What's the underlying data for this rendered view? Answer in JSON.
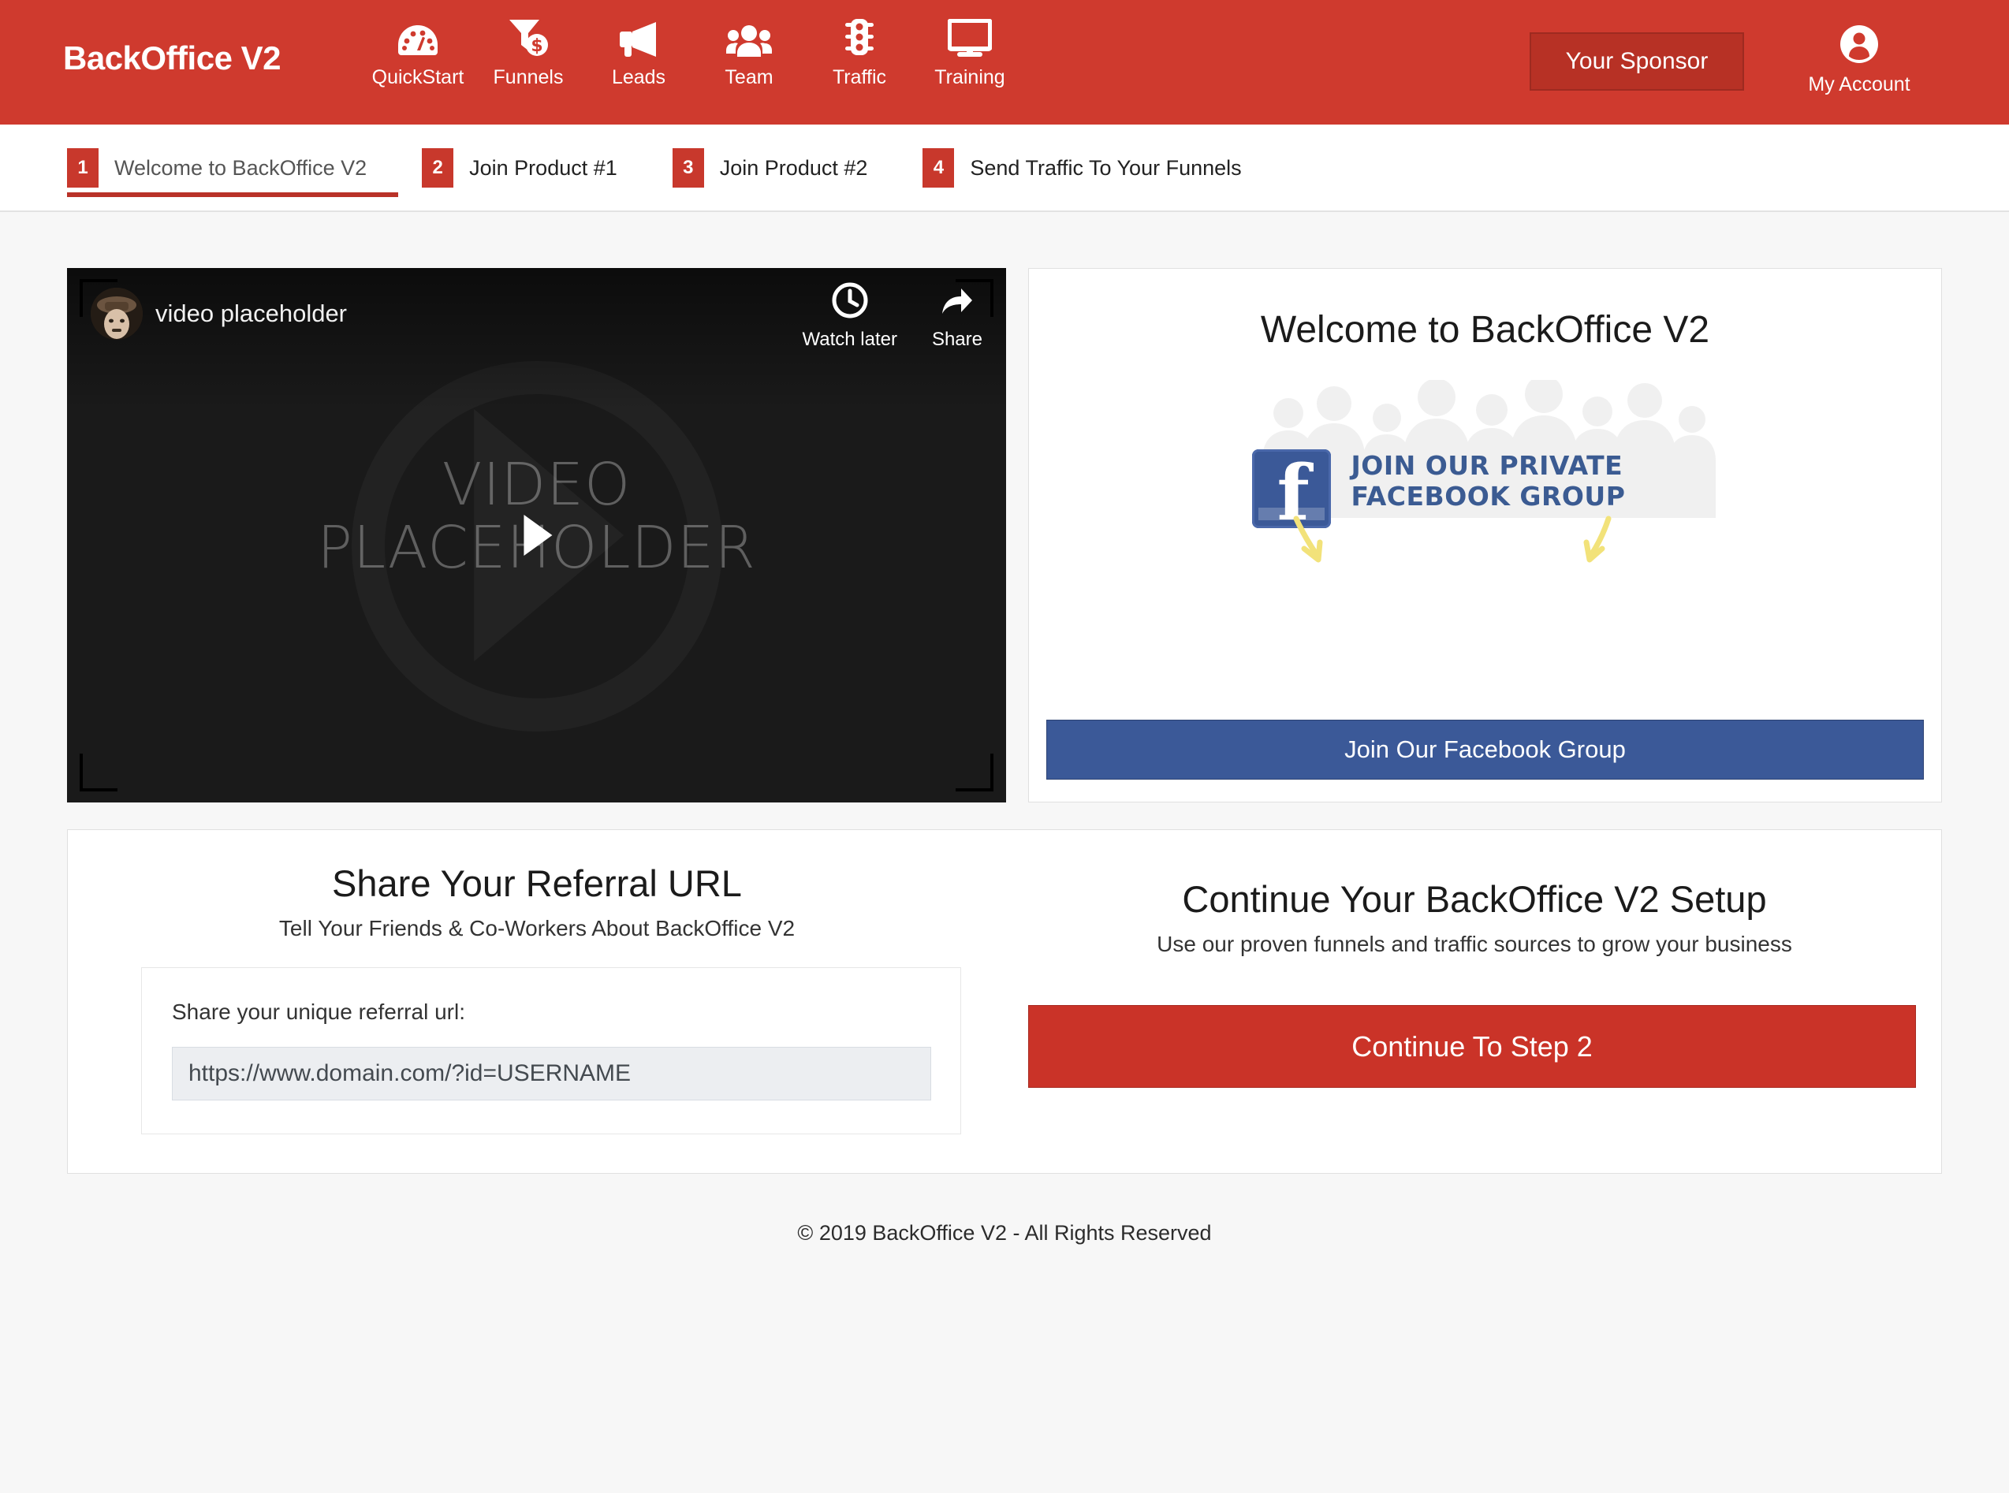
{
  "header": {
    "brand": "BackOffice V2",
    "nav": [
      {
        "label": "QuickStart",
        "icon": "speedometer-icon"
      },
      {
        "label": "Funnels",
        "icon": "funnel-dollar-icon"
      },
      {
        "label": "Leads",
        "icon": "megaphone-icon"
      },
      {
        "label": "Team",
        "icon": "people-group-icon"
      },
      {
        "label": "Traffic",
        "icon": "traffic-light-icon"
      },
      {
        "label": "Training",
        "icon": "desktop-monitor-icon"
      }
    ],
    "sponsor_button": "Your Sponsor",
    "account_label": "My Account",
    "account_icon": "user-circle-icon",
    "bar_color": "#cf3a2e"
  },
  "steps": [
    {
      "num": "1",
      "label": "Welcome to BackOffice V2",
      "active": true
    },
    {
      "num": "2",
      "label": "Join Product #1",
      "active": false
    },
    {
      "num": "3",
      "label": "Join Product #2",
      "active": false
    },
    {
      "num": "4",
      "label": "Send Traffic To Your Funnels",
      "active": false
    }
  ],
  "video": {
    "title": "video placeholder",
    "watermark_line1": "VIDEO",
    "watermark_line2": "PLACEHOLDER",
    "watch_later": "Watch later",
    "watch_later_icon": "clock-icon",
    "share": "Share",
    "share_icon": "share-arrow-icon",
    "play_icon": "play-icon",
    "avatar_icon": "channel-avatar"
  },
  "welcome_panel": {
    "title": "Welcome to BackOffice V2",
    "graphic_line1": "JOIN OUR PRIVATE",
    "graphic_line2": "FACEBOOK GROUP",
    "graphic_icon": "facebook-logo-icon",
    "button": "Join Our Facebook Group",
    "button_color": "#3b5998"
  },
  "referral": {
    "heading": "Share Your Referral URL",
    "subheading": "Tell Your Friends & Co-Workers About BackOffice V2",
    "field_label": "Share your unique referral url:",
    "url_value": "https://www.domain.com/?id=USERNAME",
    "url_placeholder": "https://www.domain.com/?id=USERNAME"
  },
  "setup": {
    "heading": "Continue Your BackOffice V2 Setup",
    "subheading": "Use our proven funnels and traffic sources to grow your business",
    "button": "Continue To Step 2",
    "button_color": "#ca3328"
  },
  "footer": {
    "copyright": "© 2019 BackOffice V2 - All Rights Reserved"
  }
}
